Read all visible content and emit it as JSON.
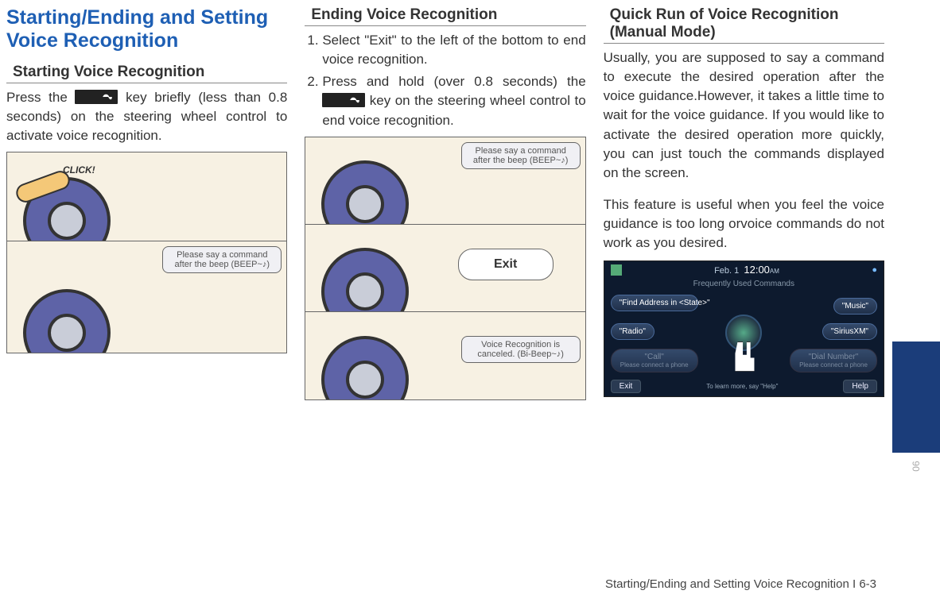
{
  "page": {
    "main_title": "Starting/Ending and Setting Voice Recognition",
    "footer": "Starting/Ending and Setting Voice Recognition I 6-3",
    "side_chapter": "06"
  },
  "col1": {
    "heading": "Starting Voice Recognition",
    "body_before_key": "Press the ",
    "body_after_key": " key briefly (less than 0.8 seconds) on the steering wheel control to activate voice recognition.",
    "illus": {
      "click_label": "CLICK!",
      "bubble2": "Please say a command after the beep (BEEP~♪)"
    }
  },
  "col2": {
    "heading": "Ending Voice Recognition",
    "step1": "Select \"Exit\" to the left of the bottom to end voice recognition.",
    "step2_before_key": "Press and hold (over 0.8 seconds) the ",
    "step2_after_key": " key on the steering wheel control to end voice recognition.",
    "illus": {
      "bubble1": "Please say a command after the beep (BEEP~♪)",
      "bubble_exit": "Exit",
      "bubble3": "Voice Recognition is canceled. (Bi-Beep~♪)"
    }
  },
  "col3": {
    "heading": "Quick Run of Voice Recognition (Manual Mode)",
    "para1": "Usually, you are supposed to say a command to execute the desired operation after the voice guidance.However, it takes a little time to wait for the voice guidance. If you would like to activate the desired operation more quickly, you can just touch the commands displayed on the screen.",
    "para2": "This feature is useful when you feel the voice guidance is too long orvoice commands do not work as you desired.",
    "screen": {
      "date": "Feb.   1",
      "time": "12:00",
      "ampm": "AM",
      "sub": "Frequently Used Commands",
      "cmd_find": "\"Find Address in <State>\"",
      "cmd_music": "\"Music\"",
      "cmd_radio": "\"Radio\"",
      "cmd_sirius": "\"SiriusXM\"",
      "cmd_call": "\"Call\"",
      "cmd_call_sub": "Please connect a phone",
      "cmd_dial": "\"Dial Number\"",
      "cmd_dial_sub": "Please connect a phone",
      "exit": "Exit",
      "help_hint": "To learn more, say \"Help\"",
      "help": "Help"
    }
  }
}
